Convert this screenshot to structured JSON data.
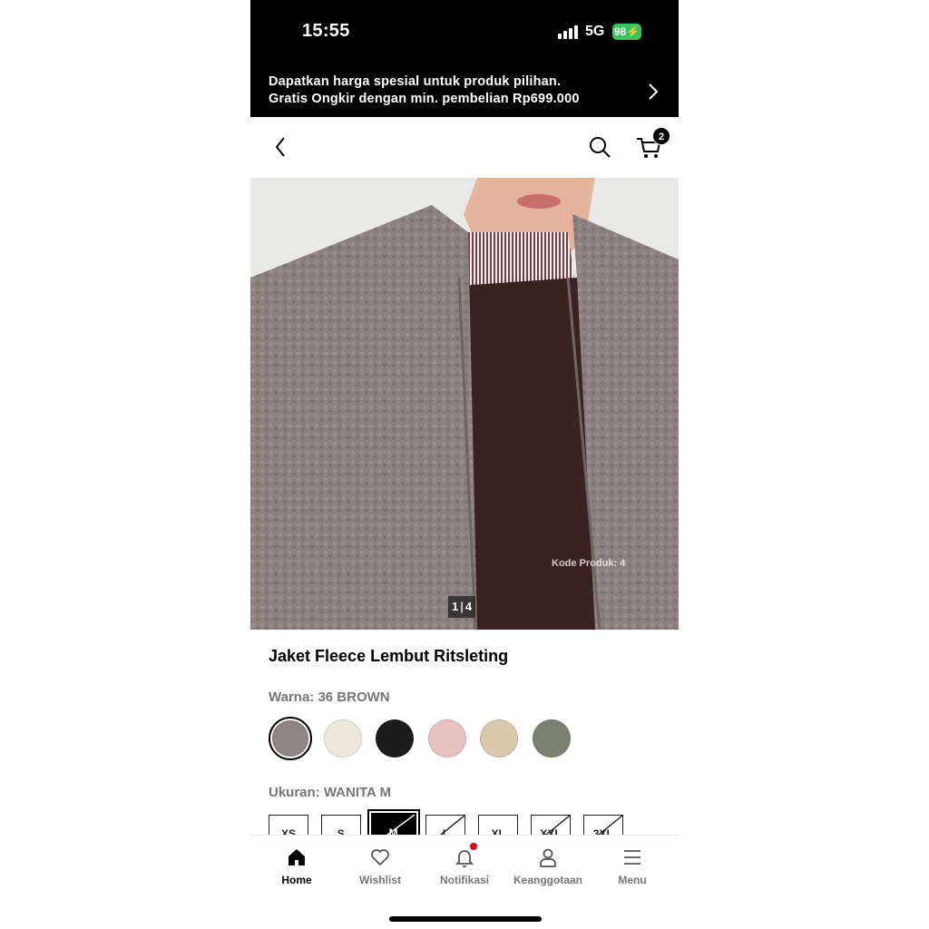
{
  "status_bar": {
    "time": "15:55",
    "network": "5G",
    "battery": "98"
  },
  "promo": {
    "line1": "Dapatkan harga spesial untuk produk pilihan.",
    "line2": "Gratis Ongkir dengan min. pembelian Rp699.000"
  },
  "header": {
    "cart_count": "2"
  },
  "product": {
    "image_counter_current": "1",
    "image_counter_total": "4",
    "product_code_label": "Kode Produk: 4",
    "title": "Jaket Fleece Lembut Ritsleting",
    "color_label": "Warna: 36 BROWN",
    "colors": [
      {
        "name": "brown",
        "hex": "#8f8582",
        "selected": true
      },
      {
        "name": "off-white",
        "hex": "#ede8dc",
        "selected": false
      },
      {
        "name": "black",
        "hex": "#1c1c1c",
        "selected": false
      },
      {
        "name": "pink",
        "hex": "#e8c2c0",
        "selected": false
      },
      {
        "name": "beige",
        "hex": "#d9c9ad",
        "selected": false
      },
      {
        "name": "olive",
        "hex": "#7b8170",
        "selected": false
      }
    ],
    "size_label": "Ukuran: WANITA M",
    "sizes": [
      {
        "label": "XS",
        "available": true,
        "selected": false
      },
      {
        "label": "S",
        "available": true,
        "selected": false
      },
      {
        "label": "M",
        "available": false,
        "selected": true
      },
      {
        "label": "L",
        "available": false,
        "selected": false
      },
      {
        "label": "XL",
        "available": true,
        "selected": false
      },
      {
        "label": "XXL",
        "available": false,
        "selected": false
      },
      {
        "label": "3XL",
        "available": false,
        "selected": false
      }
    ]
  },
  "tabbar": {
    "home": "Home",
    "wishlist": "Wishlist",
    "notifications": "Notifikasi",
    "membership": "Keanggotaan",
    "menu": "Menu"
  },
  "colors": {
    "accent": "#000000",
    "badge_red": "#e60012",
    "battery_green": "#34c759"
  }
}
